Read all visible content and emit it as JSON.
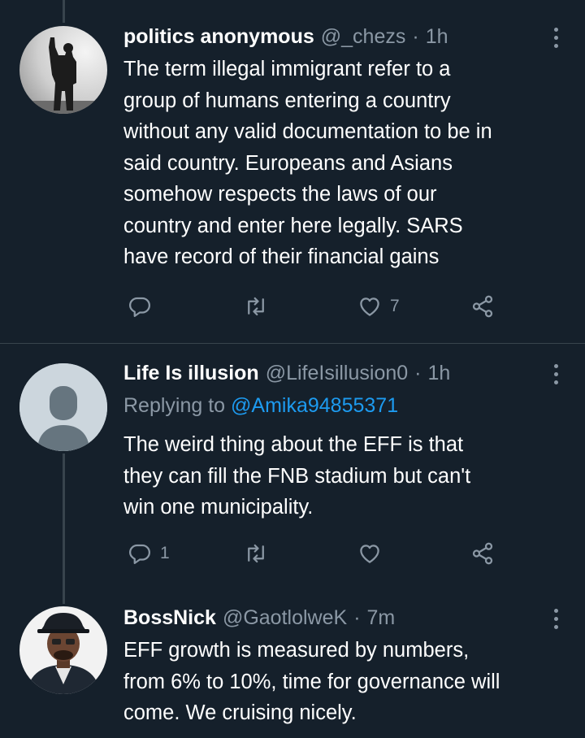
{
  "tweets": [
    {
      "name": "politics anonymous",
      "handle": "@_chezs",
      "sep": "·",
      "time": "1h",
      "avatar": "silhouette-statue-raised-fist",
      "lines": [
        "The term illegal immigrant refer to a",
        "group of humans entering a country",
        "without any valid documentation to be in",
        "said country. Europeans and Asians",
        "somehow respects the laws of our",
        "country and enter here legally. SARS",
        "have record of their financial gains"
      ],
      "replies": "",
      "retweets": "",
      "likes": "7"
    },
    {
      "name": "Life Is illusion",
      "handle": "@LifeIsillusion0",
      "sep": "·",
      "time": "1h",
      "avatar": "default-avatar",
      "replying_prefix": "Replying to",
      "replying_to": "@Amika94855371",
      "lines": [
        "The weird thing about the EFF is that",
        "they can fill the FNB stadium but can't",
        "win one municipality."
      ],
      "replies": "1",
      "retweets": "",
      "likes": ""
    },
    {
      "name": "BossNick",
      "handle": "@GaotlolweK",
      "sep": "·",
      "time": "7m",
      "avatar": "man-in-hat-photo",
      "lines": [
        "EFF growth is measured by numbers,",
        "from 6% to 10%, time for governance will",
        "come. We cruising nicely."
      ]
    }
  ],
  "icons": [
    "reply-icon",
    "retweet-icon",
    "like-icon",
    "share-icon",
    "more-icon"
  ],
  "colors": {
    "background": "#15202b",
    "secondary_text": "#8b98a5",
    "link": "#1d9bf0",
    "divider": "#38444d"
  }
}
